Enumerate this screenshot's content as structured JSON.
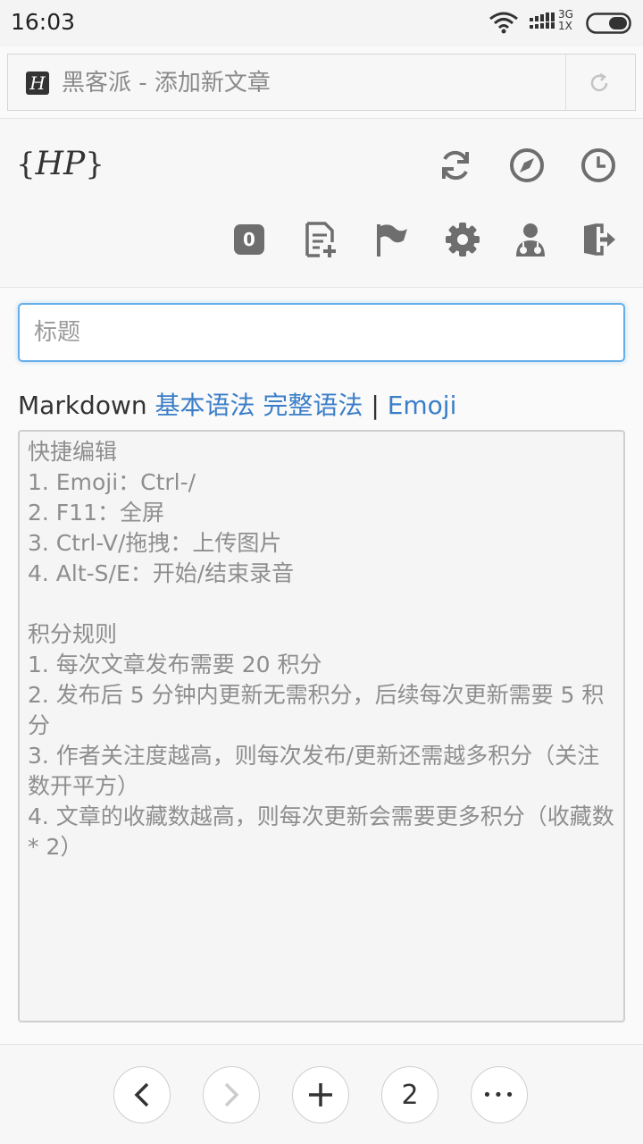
{
  "status_bar": {
    "time": "16:03",
    "network_top": "3G",
    "network_bottom": "1X"
  },
  "browser": {
    "favicon_letter": "H",
    "page_title": "黑客派 - 添加新文章"
  },
  "header": {
    "logo_left": "{",
    "logo_mark": "HP",
    "logo_right": "}",
    "notification_count": "0",
    "icons": [
      "refresh-icon",
      "compass-icon",
      "clock-icon",
      "new-article-icon",
      "flag-icon",
      "gear-icon",
      "user-md-icon",
      "logout-icon"
    ]
  },
  "form": {
    "title_placeholder": "标题",
    "markdown_label": "Markdown ",
    "basic_syntax": "基本语法",
    "full_syntax": "完整语法",
    "separator": "|",
    "emoji_link": "Emoji",
    "editor_lines": [
      "快捷编辑",
      "1. Emoji：Ctrl-/",
      "2. F11：全屏",
      "3. Ctrl-V/拖拽：上传图片",
      "4. Alt-S/E：开始/结束录音",
      "",
      "积分规则",
      "1. 每次文章发布需要 20 积分",
      "2. 发布后 5 分钟内更新无需积分，后续每次更新需要 5 积分",
      "3. 作者关注度越高，则每次发布/更新还需越多积分（关注数开平方）",
      "4. 文章的收藏数越高，则每次更新会需要更多积分（收藏数 * 2）"
    ]
  },
  "bottom_bar": {
    "back": "‹",
    "forward": "›",
    "add": "+",
    "tabs_count": "2",
    "more": "•••"
  },
  "colors": {
    "link": "#3b7ec8",
    "focus_border": "#66afe9",
    "icon_gray": "#6e6e6e"
  }
}
